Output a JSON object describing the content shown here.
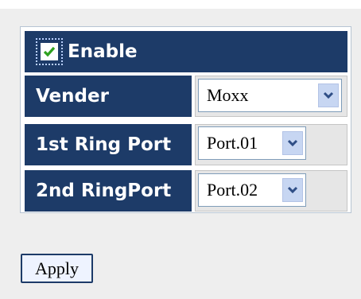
{
  "ring": {
    "enable_label": "Enable",
    "enable_checked": true,
    "vender_label": "Vender",
    "vender_value": "Moxx",
    "port1_label": "1st Ring Port",
    "port1_value": "Port.01",
    "port2_label": "2nd RingPort",
    "port2_value": "Port.02"
  },
  "actions": {
    "apply_label": "Apply"
  },
  "colors": {
    "header_bg": "#1d3b68",
    "accent_check": "#2fa11f"
  },
  "icons": {
    "checkbox": "checkmark-icon",
    "dropdown": "chevron-down-icon"
  }
}
